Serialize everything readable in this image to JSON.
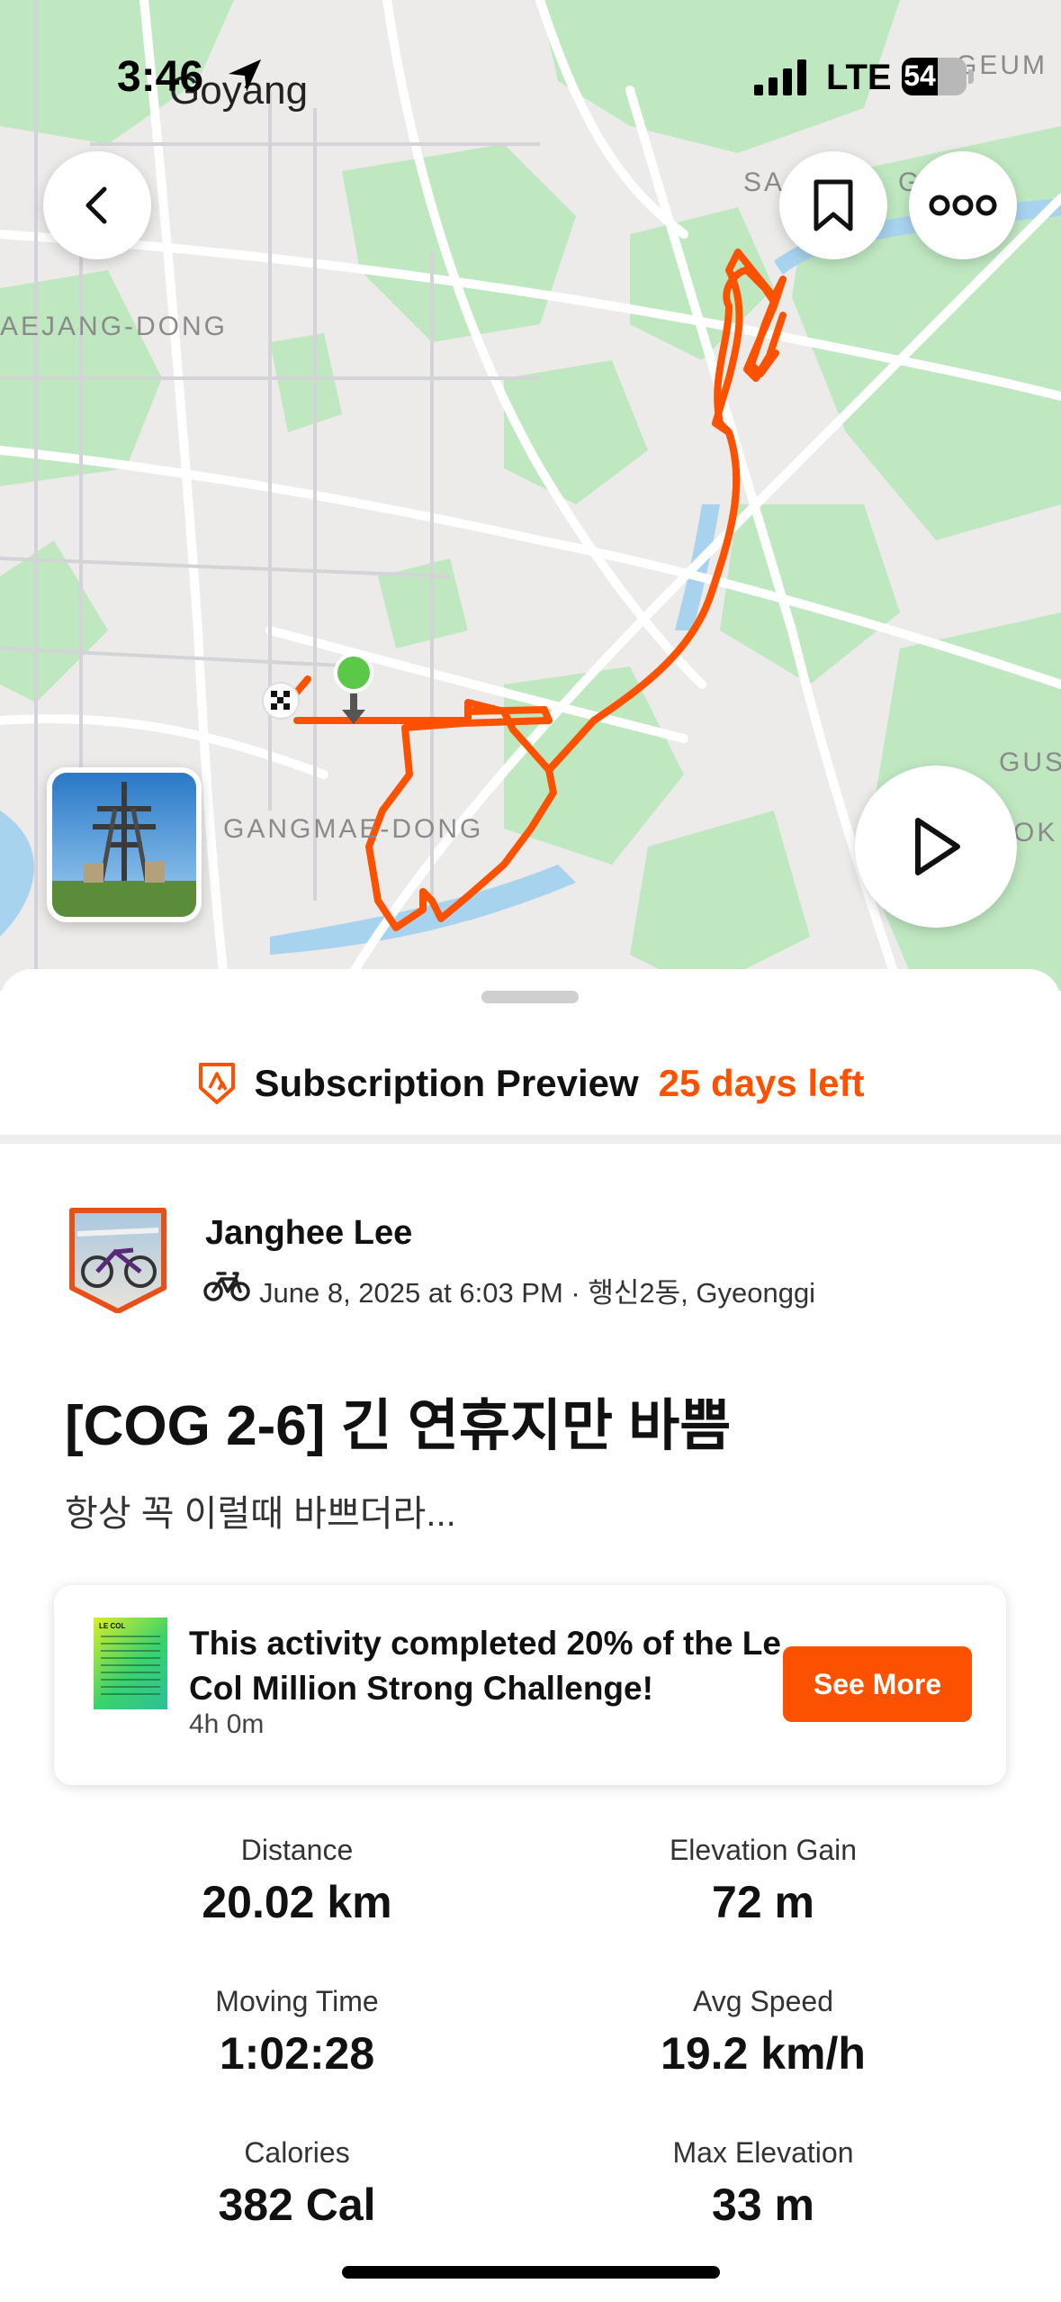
{
  "status_bar": {
    "time": "3:46",
    "network": "LTE",
    "battery": "54"
  },
  "map": {
    "labels": {
      "goyang": "Goyang",
      "aejang": "AEJANG-DONG",
      "gangmae": "GANGMAE-DONG",
      "sa": "SA",
      "g": "G",
      "geum": "GEUM",
      "gus": "GUS",
      "ok": "OK"
    },
    "route_color": "#fc5200"
  },
  "subscription": {
    "title": "Subscription Preview",
    "days_left": "25 days left"
  },
  "athlete": {
    "name": "Janghee Lee",
    "meta": "June 8, 2025 at 6:03 PM · 행신2동, Gyeonggi"
  },
  "activity": {
    "title": "[COG 2-6] 긴 연휴지만 바쁨",
    "description": "항상 꼭 이럴때 바쁘더라..."
  },
  "challenge": {
    "text": "This activity completed 20% of the Le Col Million Strong Challenge!",
    "duration": "4h 0m",
    "button": "See More",
    "progress_fraction": 0.2
  },
  "stats": [
    {
      "label": "Distance",
      "value": "20.02 km"
    },
    {
      "label": "Elevation Gain",
      "value": "72 m"
    },
    {
      "label": "Moving Time",
      "value": "1:02:28"
    },
    {
      "label": "Avg Speed",
      "value": "19.2 km/h"
    },
    {
      "label": "Calories",
      "value": "382 Cal"
    },
    {
      "label": "Max Elevation",
      "value": "33 m"
    }
  ],
  "colors": {
    "accent": "#fc5200",
    "map_green": "#bfe8c1",
    "map_bg": "#ecebe9"
  }
}
